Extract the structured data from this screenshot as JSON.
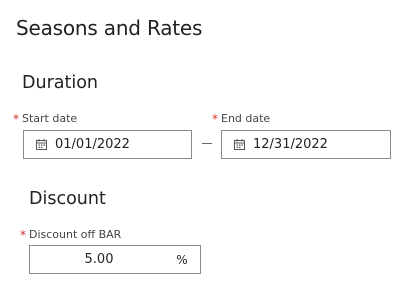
{
  "page": {
    "title": "Seasons and Rates"
  },
  "duration": {
    "title": "Duration",
    "start": {
      "label": "Start date",
      "required_mark": "*",
      "value": "01/01/2022",
      "icon": "calendar-icon"
    },
    "separator": "—",
    "end": {
      "label": "End date",
      "required_mark": "*",
      "value": "12/31/2022",
      "icon": "calendar-icon"
    }
  },
  "discount": {
    "title": "Discount",
    "field": {
      "label": "Discount off BAR",
      "required_mark": "*",
      "value": "5.00",
      "unit": "%"
    }
  },
  "colors": {
    "required": "#d93025",
    "border": "#8c8c8c",
    "text": "#222222"
  }
}
